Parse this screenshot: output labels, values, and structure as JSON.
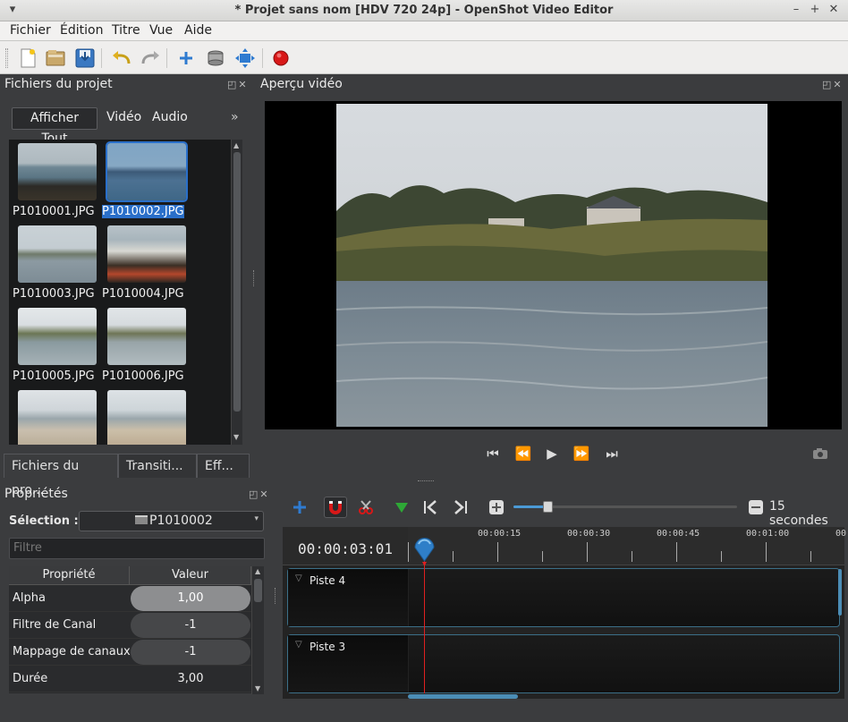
{
  "window": {
    "title": "* Projet sans nom [HDV 720 24p] - OpenShot Video Editor",
    "controls": [
      "–",
      "+",
      "✕"
    ]
  },
  "menu": [
    "Fichier",
    "Édition",
    "Titre",
    "Vue",
    "Aide"
  ],
  "toolbar_icons": [
    "new-project-icon",
    "open-project-icon",
    "save-project-icon",
    "undo-icon",
    "redo-icon",
    "import-files-icon",
    "profile-icon",
    "fullscreen-icon",
    "export-video-icon"
  ],
  "project_files": {
    "title": "Fichiers du projet",
    "filters": [
      "Afficher Tout",
      "Vidéo",
      "Audio"
    ],
    "more": "»",
    "files": [
      {
        "name": "P1010001.JPG",
        "selected": false
      },
      {
        "name": "P1010002.JPG",
        "selected": true
      },
      {
        "name": "P1010003.JPG",
        "selected": false
      },
      {
        "name": "P1010004.JPG",
        "selected": false
      },
      {
        "name": "P1010005.JPG",
        "selected": false
      },
      {
        "name": "P1010006.JPG",
        "selected": false
      },
      {
        "name": "",
        "selected": false
      },
      {
        "name": "",
        "selected": false
      }
    ]
  },
  "bottom_tabs": [
    "Fichiers du pro...",
    "Transiti...",
    "Eff..."
  ],
  "properties": {
    "title": "Propriétés",
    "selection_label": "Sélection :",
    "selection_value": "P1010002",
    "filter_placeholder": "Filtre",
    "columns": [
      "Propriété",
      "Valeur"
    ],
    "rows": [
      {
        "name": "Alpha",
        "value": "1,00",
        "fill": 1.0
      },
      {
        "name": "Filtre de Canal",
        "value": "-1",
        "fill": 0
      },
      {
        "name": "Mappage de canaux",
        "value": "-1",
        "fill": 0
      },
      {
        "name": "Durée",
        "value": "3,00",
        "fill": 0
      }
    ]
  },
  "preview": {
    "title": "Aperçu vidéo"
  },
  "playback_icons": [
    "jump-start-icon",
    "rewind-icon",
    "play-icon",
    "fast-forward-icon",
    "jump-end-icon"
  ],
  "timeline": {
    "zoom_label": "15 secondes",
    "zoom_fraction": 0.15,
    "timecode": "00:00:03:01",
    "ruler_labels": [
      "00:00:15",
      "00:00:30",
      "00:00:45",
      "00:01:00",
      "00"
    ],
    "tracks": [
      "Piste 4",
      "Piste 3"
    ]
  },
  "colors": {
    "selection": "#2a6fc9",
    "playhead": "#e02020",
    "track_border": "#3c6f88",
    "record": "#d81818"
  }
}
